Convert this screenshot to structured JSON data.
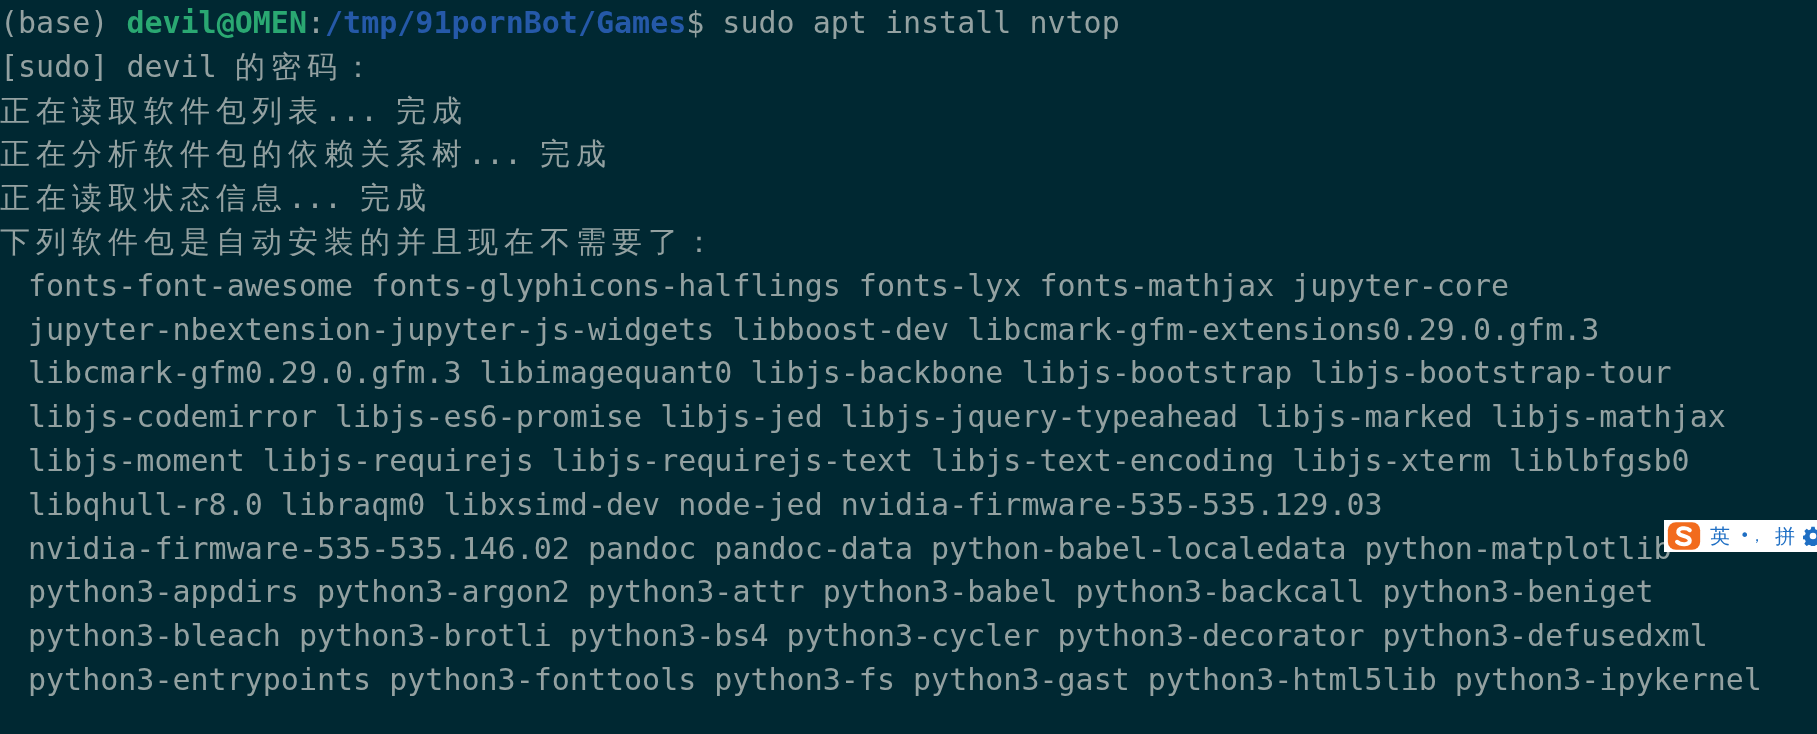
{
  "prompt": {
    "env": "(base)",
    "user_host": "devil@OMEN",
    "separator": ":",
    "path": "/tmp/91pornBot/Games",
    "symbol": "$",
    "command": "sudo apt install nvtop"
  },
  "output_lines": [
    "[sudo] devil 的密码：",
    "正在读取软件包列表... 完成",
    "正在分析软件包的依赖关系树... 完成",
    "正在读取状态信息... 完成",
    "下列软件包是自动安装的并且现在不需要了："
  ],
  "package_lines": [
    "fonts-font-awesome fonts-glyphicons-halflings fonts-lyx fonts-mathjax jupyter-core",
    "jupyter-nbextension-jupyter-js-widgets libboost-dev libcmark-gfm-extensions0.29.0.gfm.3",
    "libcmark-gfm0.29.0.gfm.3 libimagequant0 libjs-backbone libjs-bootstrap libjs-bootstrap-tour",
    "libjs-codemirror libjs-es6-promise libjs-jed libjs-jquery-typeahead libjs-marked libjs-mathjax",
    "libjs-moment libjs-requirejs libjs-requirejs-text libjs-text-encoding libjs-xterm liblbfgsb0",
    "libqhull-r8.0 libraqm0 libxsimd-dev node-jed nvidia-firmware-535-535.129.03",
    "nvidia-firmware-535-535.146.02 pandoc pandoc-data python-babel-localedata python-matplotlib",
    "python3-appdirs python3-argon2 python3-attr python3-babel python3-backcall python3-beniget",
    "python3-bleach python3-brotli python3-bs4 python3-cycler python3-decorator python3-defusedxml",
    "python3-entrypoints python3-fonttools python3-fs python3-gast python3-html5lib python3-ipykernel"
  ],
  "ime_toolbar": {
    "mode": "英",
    "punctuation": "•，",
    "input": "拼"
  }
}
